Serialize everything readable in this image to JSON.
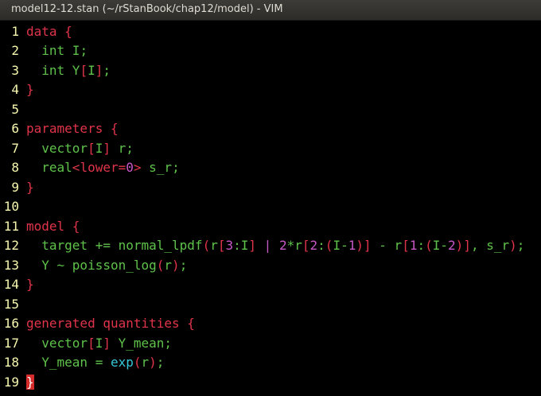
{
  "window": {
    "title": "model12-12.stan (~/rStanBook/chap12/model) - VIM"
  },
  "colors": {
    "background": "#000000",
    "line_number": "#f7f7b0",
    "keyword": "#e0344a",
    "type": "#5fc24a",
    "number": "#c858c8",
    "function": "#35c8d8",
    "operator": "#e8e8e8",
    "cursor": "#d52b2b"
  },
  "editor": {
    "lines": [
      {
        "number": "1",
        "tokens": [
          {
            "t": "data {",
            "c": "keyword"
          }
        ]
      },
      {
        "number": "2",
        "tokens": [
          {
            "t": "  ",
            "c": "operator"
          },
          {
            "t": "int",
            "c": "type"
          },
          {
            "t": " I;",
            "c": "type"
          }
        ]
      },
      {
        "number": "3",
        "tokens": [
          {
            "t": "  ",
            "c": "operator"
          },
          {
            "t": "int",
            "c": "type"
          },
          {
            "t": " Y",
            "c": "type"
          },
          {
            "t": "[",
            "c": "keyword"
          },
          {
            "t": "I",
            "c": "type"
          },
          {
            "t": "]",
            "c": "keyword"
          },
          {
            "t": ";",
            "c": "type"
          }
        ]
      },
      {
        "number": "4",
        "tokens": [
          {
            "t": "}",
            "c": "keyword"
          }
        ]
      },
      {
        "number": "5",
        "tokens": []
      },
      {
        "number": "6",
        "tokens": [
          {
            "t": "parameters {",
            "c": "keyword"
          }
        ]
      },
      {
        "number": "7",
        "tokens": [
          {
            "t": "  ",
            "c": "operator"
          },
          {
            "t": "vector",
            "c": "type"
          },
          {
            "t": "[",
            "c": "keyword"
          },
          {
            "t": "I",
            "c": "type"
          },
          {
            "t": "]",
            "c": "keyword"
          },
          {
            "t": " r;",
            "c": "type"
          }
        ]
      },
      {
        "number": "8",
        "tokens": [
          {
            "t": "  ",
            "c": "operator"
          },
          {
            "t": "real",
            "c": "type"
          },
          {
            "t": "<",
            "c": "keyword"
          },
          {
            "t": "lower",
            "c": "keyword"
          },
          {
            "t": "=",
            "c": "keyword"
          },
          {
            "t": "0",
            "c": "number"
          },
          {
            "t": ">",
            "c": "keyword"
          },
          {
            "t": " s_r;",
            "c": "type"
          }
        ]
      },
      {
        "number": "9",
        "tokens": [
          {
            "t": "}",
            "c": "keyword"
          }
        ]
      },
      {
        "number": "10",
        "tokens": []
      },
      {
        "number": "11",
        "tokens": [
          {
            "t": "model {",
            "c": "keyword"
          }
        ]
      },
      {
        "number": "12",
        "tokens": [
          {
            "t": "  ",
            "c": "operator"
          },
          {
            "t": "target += ",
            "c": "type"
          },
          {
            "t": "normal_lpdf",
            "c": "type"
          },
          {
            "t": "(",
            "c": "keyword"
          },
          {
            "t": "r",
            "c": "type"
          },
          {
            "t": "[",
            "c": "keyword"
          },
          {
            "t": "3",
            "c": "number"
          },
          {
            "t": ":",
            "c": "type"
          },
          {
            "t": "I",
            "c": "type"
          },
          {
            "t": "]",
            "c": "keyword"
          },
          {
            "t": " | ",
            "c": "number"
          },
          {
            "t": "2",
            "c": "number"
          },
          {
            "t": "*",
            "c": "type"
          },
          {
            "t": "r",
            "c": "type"
          },
          {
            "t": "[",
            "c": "keyword"
          },
          {
            "t": "2",
            "c": "number"
          },
          {
            "t": ":",
            "c": "type"
          },
          {
            "t": "(",
            "c": "keyword"
          },
          {
            "t": "I",
            "c": "type"
          },
          {
            "t": "-",
            "c": "type"
          },
          {
            "t": "1",
            "c": "number"
          },
          {
            "t": ")",
            "c": "keyword"
          },
          {
            "t": "]",
            "c": "keyword"
          },
          {
            "t": " - ",
            "c": "type"
          },
          {
            "t": "r",
            "c": "type"
          },
          {
            "t": "[",
            "c": "keyword"
          },
          {
            "t": "1",
            "c": "number"
          },
          {
            "t": ":",
            "c": "type"
          },
          {
            "t": "(",
            "c": "keyword"
          },
          {
            "t": "I",
            "c": "type"
          },
          {
            "t": "-",
            "c": "type"
          },
          {
            "t": "2",
            "c": "number"
          },
          {
            "t": ")",
            "c": "keyword"
          },
          {
            "t": "]",
            "c": "keyword"
          },
          {
            "t": ", s_r",
            "c": "type"
          },
          {
            "t": ")",
            "c": "keyword"
          },
          {
            "t": ";",
            "c": "type"
          }
        ]
      },
      {
        "number": "13",
        "tokens": [
          {
            "t": "  ",
            "c": "operator"
          },
          {
            "t": "Y ~ ",
            "c": "type"
          },
          {
            "t": "poisson_log",
            "c": "type"
          },
          {
            "t": "(",
            "c": "keyword"
          },
          {
            "t": "r",
            "c": "type"
          },
          {
            "t": ")",
            "c": "keyword"
          },
          {
            "t": ";",
            "c": "type"
          }
        ]
      },
      {
        "number": "14",
        "tokens": [
          {
            "t": "}",
            "c": "keyword"
          }
        ]
      },
      {
        "number": "15",
        "tokens": []
      },
      {
        "number": "16",
        "tokens": [
          {
            "t": "generated quantities {",
            "c": "keyword"
          }
        ]
      },
      {
        "number": "17",
        "tokens": [
          {
            "t": "  ",
            "c": "operator"
          },
          {
            "t": "vector",
            "c": "type"
          },
          {
            "t": "[",
            "c": "keyword"
          },
          {
            "t": "I",
            "c": "type"
          },
          {
            "t": "]",
            "c": "keyword"
          },
          {
            "t": " Y_mean;",
            "c": "type"
          }
        ]
      },
      {
        "number": "18",
        "tokens": [
          {
            "t": "  ",
            "c": "operator"
          },
          {
            "t": "Y_mean = ",
            "c": "type"
          },
          {
            "t": "exp",
            "c": "function"
          },
          {
            "t": "(",
            "c": "keyword"
          },
          {
            "t": "r",
            "c": "type"
          },
          {
            "t": ")",
            "c": "keyword"
          },
          {
            "t": ";",
            "c": "type"
          }
        ]
      },
      {
        "number": "19",
        "tokens": [
          {
            "t": "}",
            "c": "cursor"
          }
        ]
      }
    ]
  }
}
